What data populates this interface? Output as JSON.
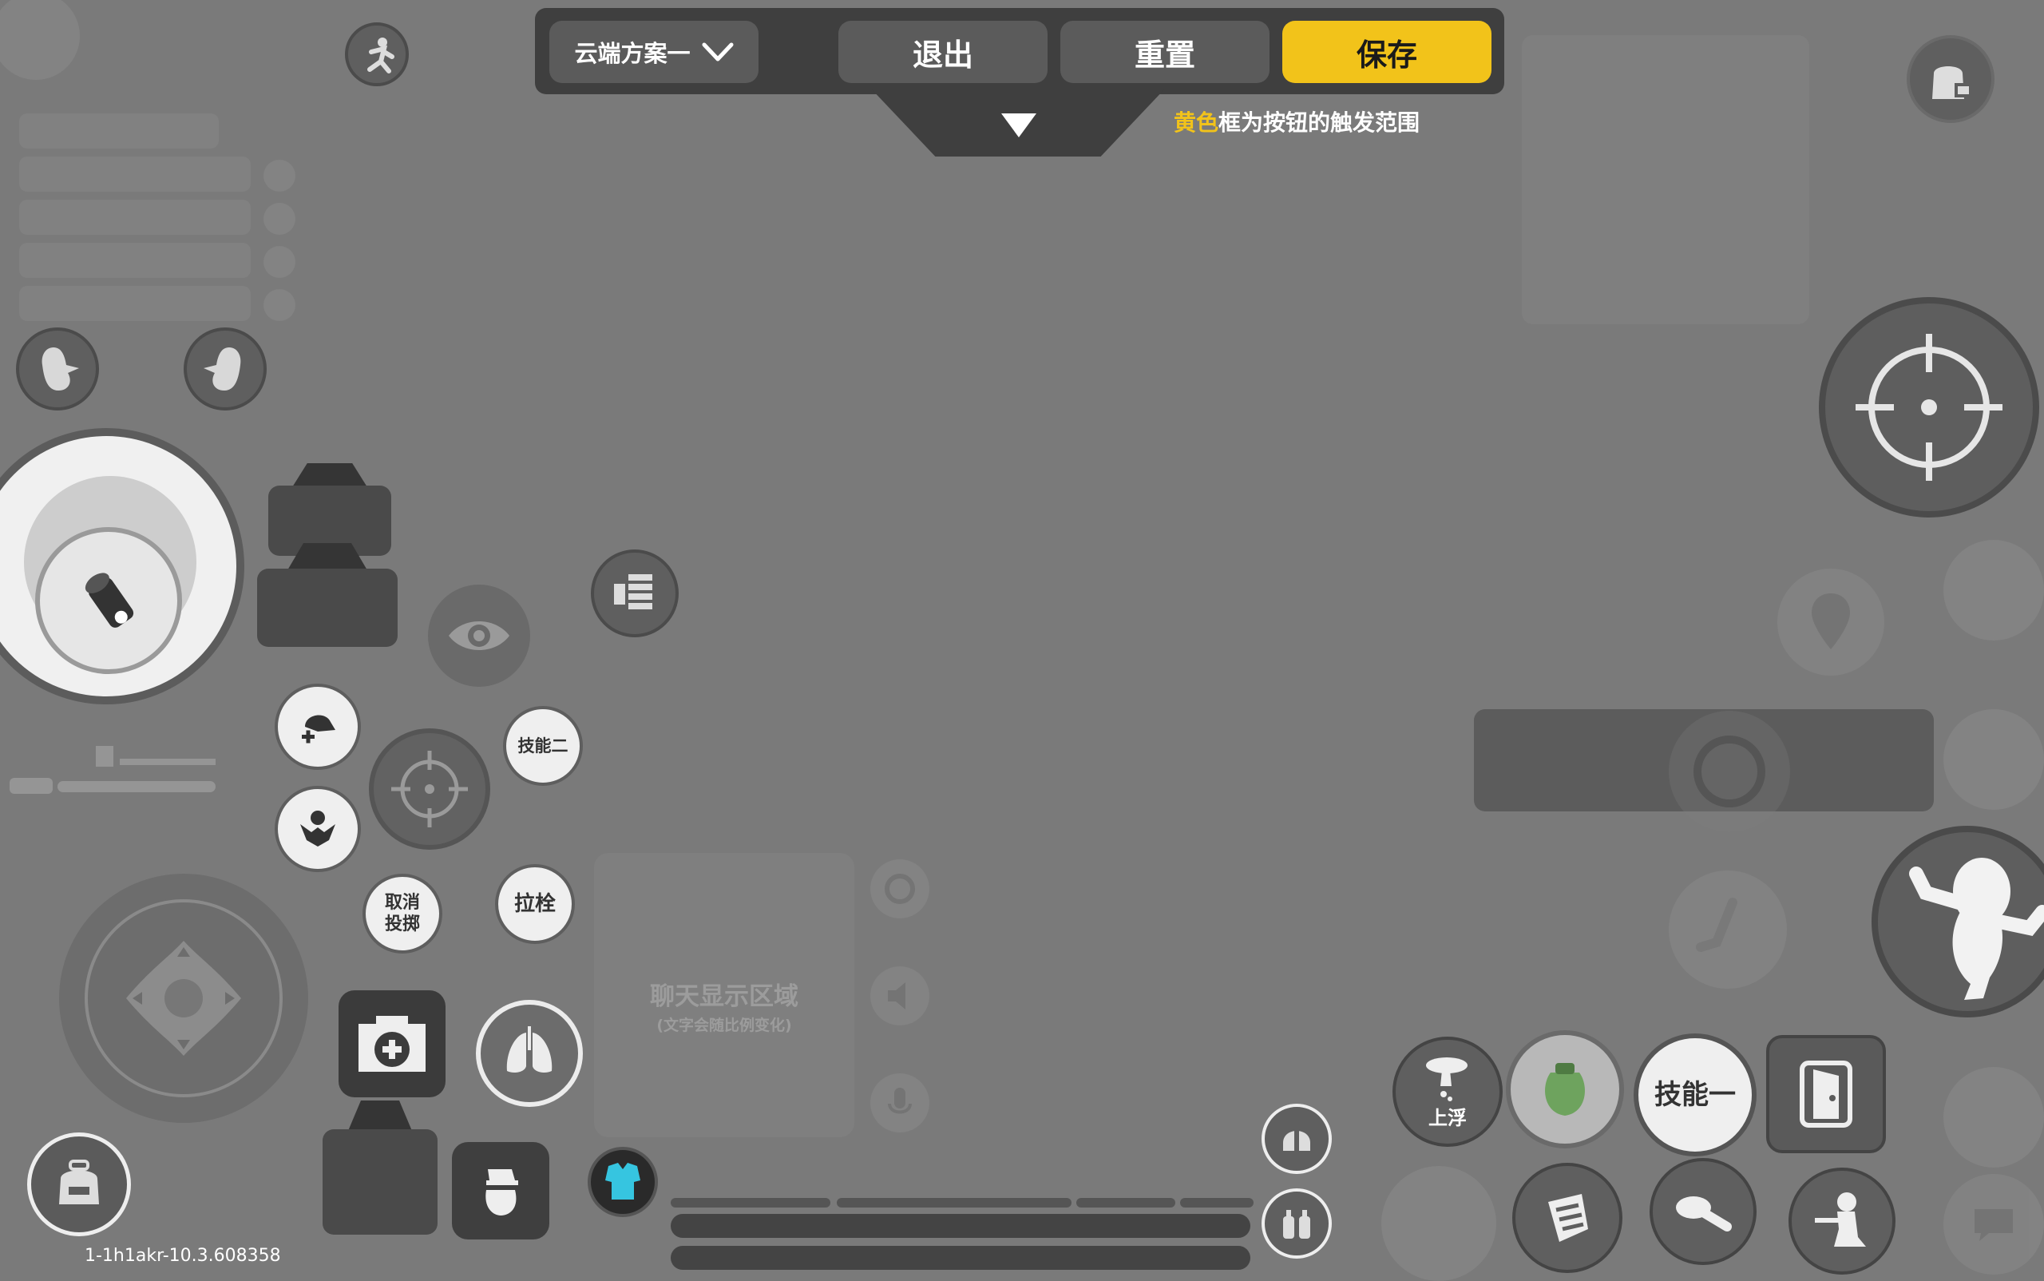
{
  "toolbar": {
    "scheme_label": "云端方案一",
    "exit_label": "退出",
    "reset_label": "重置",
    "save_label": "保存",
    "hint_highlight": "黄色",
    "hint_rest": "框为按钮的触发范围"
  },
  "buttons": {
    "skill_two": "技能二",
    "cancel_throw": "取消\n投掷",
    "pull_bolt": "拉栓",
    "float_up": "上浮",
    "skill_one": "技能一"
  },
  "chat": {
    "title": "聊天显示区域",
    "subtitle": "(文字会随比例变化)"
  },
  "footer": {
    "version": "1-1h1akr-10.3.608358"
  },
  "colors": {
    "background": "#7a7a7a",
    "toolbar": "#3f3f3f",
    "accent": "#f2c31a",
    "button_light": "#efefef",
    "button_dark": "#5f5f5f"
  }
}
